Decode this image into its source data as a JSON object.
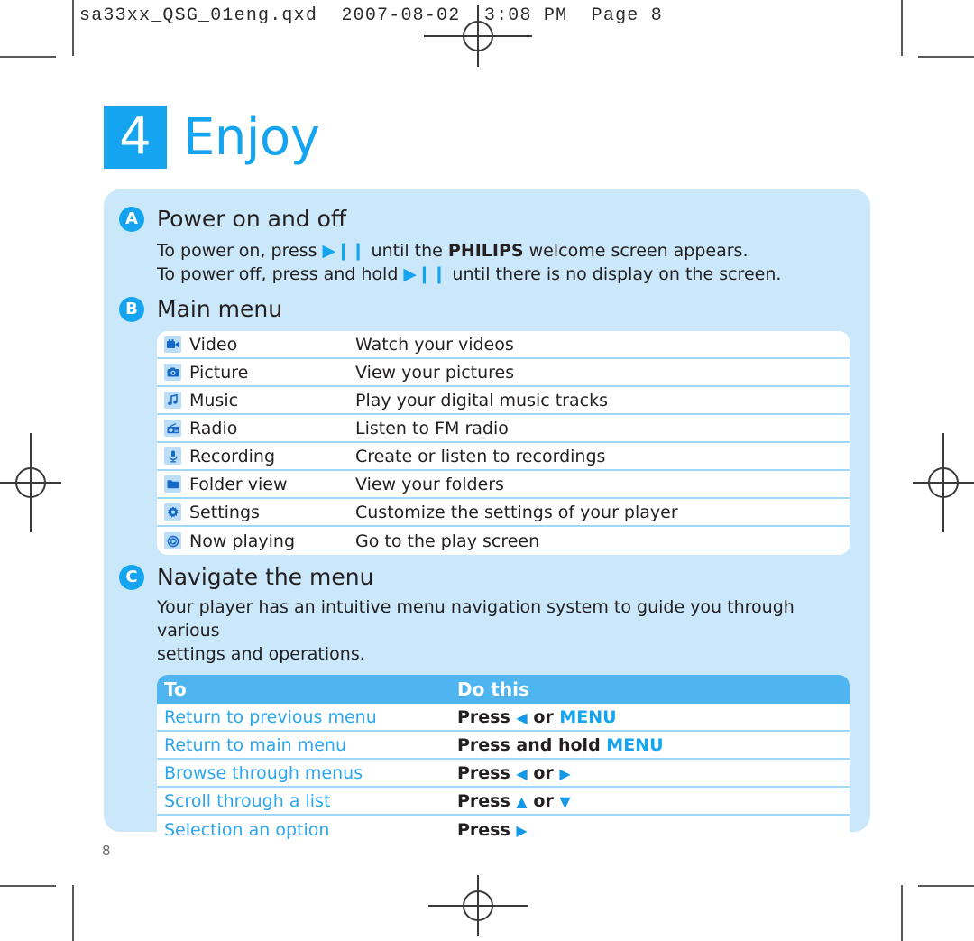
{
  "print_marks": {
    "slug_text": "sa33xx_QSG_01eng.qxd  2007-08-02  3:08 PM  Page 8",
    "registration_mark_name": "registration-mark"
  },
  "chapter": {
    "number": "4",
    "title": "Enjoy"
  },
  "sections": {
    "a": {
      "badge": "A",
      "title": "Power on and off",
      "line1_pre": "To power on, press ",
      "line1_glyph": "▶❙❙",
      "line1_mid": " until the ",
      "line1_brand": "PHILIPS",
      "line1_post": " welcome screen appears.",
      "line2_pre": "To power off, press and hold ",
      "line2_glyph": "▶❙❙",
      "line2_post": " until there is no display on the screen."
    },
    "b": {
      "badge": "B",
      "title": "Main menu",
      "rows": [
        {
          "icon": "video-camera-icon",
          "label": "Video",
          "desc": "Watch your videos"
        },
        {
          "icon": "camera-icon",
          "label": "Picture",
          "desc": "View your pictures"
        },
        {
          "icon": "music-note-icon",
          "label": "Music",
          "desc": "Play your digital music tracks"
        },
        {
          "icon": "radio-icon",
          "label": "Radio",
          "desc": "Listen to FM radio"
        },
        {
          "icon": "microphone-icon",
          "label": "Recording",
          "desc": "Create or listen to recordings"
        },
        {
          "icon": "folder-icon",
          "label": "Folder view",
          "desc": "View your folders"
        },
        {
          "icon": "gear-icon",
          "label": "Settings",
          "desc": "Customize the settings of your player"
        },
        {
          "icon": "play-circle-icon",
          "label": "Now playing",
          "desc": "Go to the play screen"
        }
      ]
    },
    "c": {
      "badge": "C",
      "title": "Navigate the menu",
      "intro_line1": "Your player has an intuitive menu navigation system to guide you through various",
      "intro_line2": "settings and operations.",
      "table": {
        "header": {
          "to": "To",
          "do_this": "Do this"
        },
        "rows": [
          {
            "to": "Return to previous menu",
            "press": "Press ",
            "g1": "◀",
            "mid": " or ",
            "kw": "MENU",
            "tail": ""
          },
          {
            "to": "Return to main menu",
            "press": "Press and hold ",
            "g1": "",
            "mid": "",
            "kw": "MENU",
            "tail": ""
          },
          {
            "to": "Browse through menus",
            "press": "Press ",
            "g1": "◀",
            "mid": " or ",
            "kw": "",
            "tail": "▶"
          },
          {
            "to": "Scroll through a list",
            "press": "Press ",
            "g1": "▲",
            "mid": " or ",
            "kw": "",
            "tail": "▼"
          },
          {
            "to": "Selection an option",
            "press": "Press ",
            "g1": "▶",
            "mid": "",
            "kw": "",
            "tail": ""
          }
        ]
      }
    }
  },
  "page_number": "8",
  "colors": {
    "brand_blue": "#14A4F0",
    "panel_blue": "#CBE8FB",
    "table_header_blue": "#4FB5F0",
    "row_separator": "#9FD8F8",
    "link_blue": "#2BA6EE"
  }
}
